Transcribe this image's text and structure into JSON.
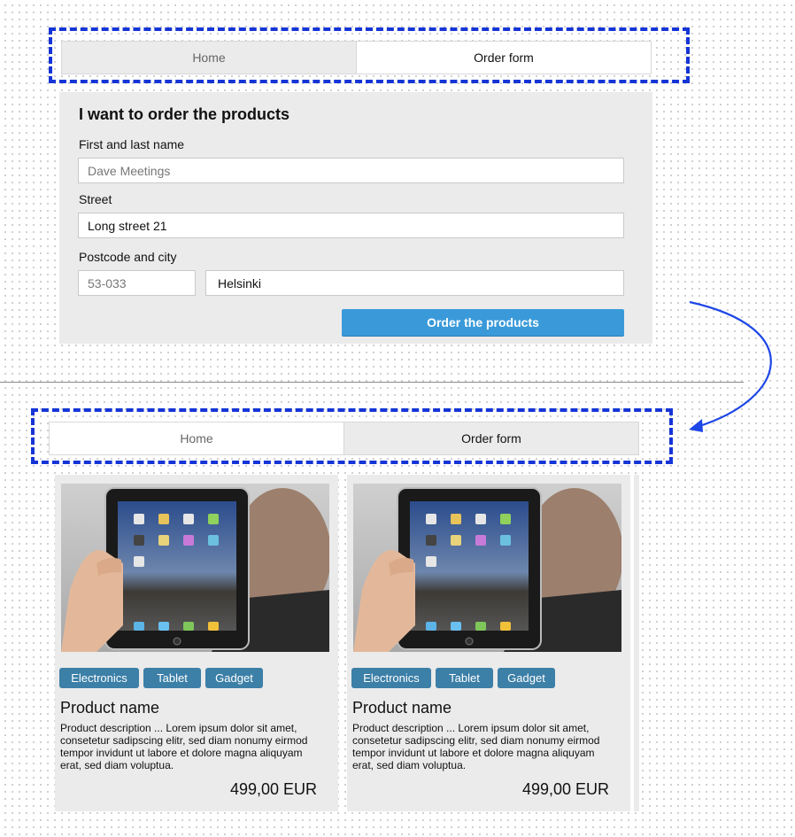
{
  "top": {
    "tabs": [
      {
        "label": "Home",
        "active": true
      },
      {
        "label": "Order form",
        "active": false
      }
    ],
    "form": {
      "title": "I want to order the products",
      "name_label": "First and last name",
      "name_placeholder": "Dave Meetings",
      "street_label": "Street",
      "street_value": "Long street 21",
      "postcode_city_label": "Postcode and city",
      "postcode_placeholder": "53-033",
      "city_value": "Helsinki",
      "submit_label": "Order the products"
    }
  },
  "bottom": {
    "tabs": [
      {
        "label": "Home",
        "active": false
      },
      {
        "label": "Order form",
        "active": true
      }
    ],
    "products": [
      {
        "tags": [
          "Electronics",
          "Tablet",
          "Gadget"
        ],
        "name": "Product name",
        "description": "Product description   ... Lorem ipsum dolor sit amet, consetetur sadipscing elitr, sed diam nonumy eirmod tempor invidunt ut labore et dolore magna aliquyam erat, sed diam voluptua.",
        "price": "499,00 EUR"
      },
      {
        "tags": [
          "Electronics",
          "Tablet",
          "Gadget"
        ],
        "name": "Product name",
        "description": "Product description   ... Lorem ipsum dolor sit amet, consetetur sadipscing elitr, sed diam nonumy eirmod tempor invidunt ut labore et dolore magna aliquyam erat, sed diam voluptua.",
        "price": "499,00 EUR"
      }
    ]
  },
  "colors": {
    "accent": "#3a9ad9",
    "tag": "#3c7fa7",
    "annotation": "#1535d6"
  }
}
